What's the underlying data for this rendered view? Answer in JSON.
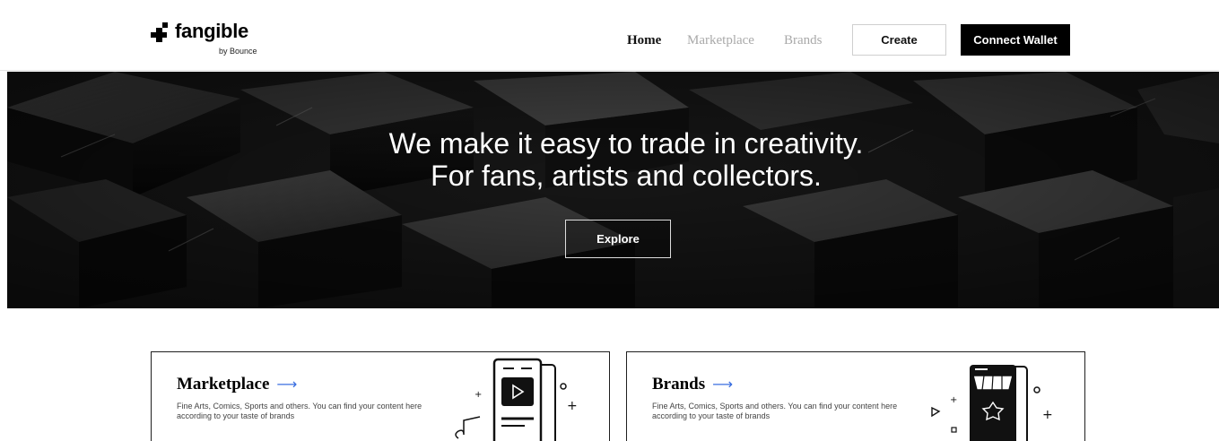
{
  "header": {
    "logo_text": "fangible",
    "logo_sub": "by Bounce",
    "nav": {
      "home": "Home",
      "marketplace": "Marketplace",
      "brands": "Brands"
    },
    "create_label": "Create",
    "connect_wallet_label": "Connect Wallet"
  },
  "hero": {
    "title_line1": "We make it easy to trade in creativity.",
    "title_line2": "For fans, artists and collectors.",
    "explore_label": "Explore"
  },
  "cards": [
    {
      "title": "Marketplace",
      "arrow": "⟶",
      "description": "Fine Arts, Comics, Sports and others. You can find your content here according to your taste of brands",
      "icon": "phone-play-icon"
    },
    {
      "title": "Brands",
      "arrow": "⟶",
      "description": "Fine Arts, Comics, Sports and others. You can find your content here according to your taste of brands",
      "icon": "phone-store-icon"
    }
  ],
  "colors": {
    "accent_arrow": "#3b6fe0",
    "wallet_button": "#000000",
    "nav_inactive": "#a9a9a9"
  }
}
